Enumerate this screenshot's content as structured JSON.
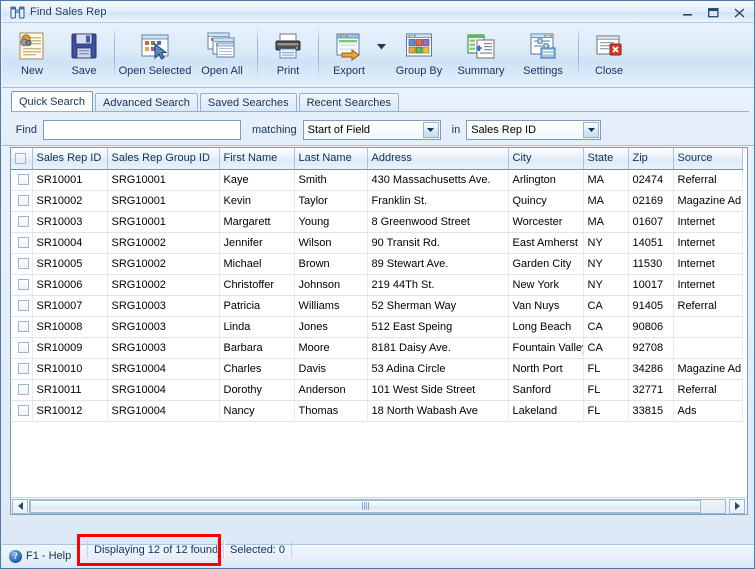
{
  "window": {
    "title": "Find Sales Rep",
    "icon": "binoculars-icon",
    "minimize_label": "Minimize",
    "maximize_label": "Maximize",
    "close_label": "Close"
  },
  "toolbar": {
    "buttons": [
      {
        "label": "New",
        "icon": "new-record-icon"
      },
      {
        "label": "Save",
        "icon": "floppy-disk-icon"
      },
      {
        "label": "Open Selected",
        "icon": "open-selected-icon"
      },
      {
        "label": "Open All",
        "icon": "open-all-icon"
      },
      {
        "label": "Print",
        "icon": "printer-icon"
      },
      {
        "label": "Export",
        "icon": "export-icon"
      },
      {
        "label": "Group By",
        "icon": "group-by-icon"
      },
      {
        "label": "Summary",
        "icon": "summary-icon"
      },
      {
        "label": "Settings",
        "icon": "settings-icon"
      },
      {
        "label": "Close",
        "icon": "close-window-icon"
      }
    ]
  },
  "search": {
    "tabs": [
      {
        "label": "Quick Search",
        "active": true
      },
      {
        "label": "Advanced Search",
        "active": false
      },
      {
        "label": "Saved Searches",
        "active": false
      },
      {
        "label": "Recent Searches",
        "active": false
      }
    ],
    "find_label": "Find",
    "find_value": "",
    "find_placeholder": "",
    "matching_label": "matching",
    "matching_value": "Start of Field",
    "in_label": "in",
    "in_value": "Sales Rep ID"
  },
  "grid": {
    "columns": [
      "Sales Rep ID",
      "Sales Rep Group ID",
      "First Name",
      "Last Name",
      "Address",
      "City",
      "State",
      "Zip",
      "Source"
    ],
    "rows": [
      [
        "SR10001",
        "SRG10001",
        "Kaye",
        "Smith",
        "430 Massachusetts Ave.",
        "Arlington",
        "MA",
        "02474",
        "Referral"
      ],
      [
        "SR10002",
        "SRG10001",
        "Kevin",
        "Taylor",
        "Franklin St.",
        "Quincy",
        "MA",
        "02169",
        "Magazine Ad"
      ],
      [
        "SR10003",
        "SRG10001",
        "Margarett",
        "Young",
        "8 Greenwood Street",
        "Worcester",
        "MA",
        "01607",
        "Internet"
      ],
      [
        "SR10004",
        "SRG10002",
        "Jennifer",
        "Wilson",
        "90 Transit Rd.",
        "East Amherst",
        "NY",
        "14051",
        "Internet"
      ],
      [
        "SR10005",
        "SRG10002",
        "Michael",
        "Brown",
        "89 Stewart Ave.",
        "Garden City",
        "NY",
        "11530",
        "Internet"
      ],
      [
        "SR10006",
        "SRG10002",
        "Christoffer",
        "Johnson",
        "219 44Th St.",
        "New York",
        "NY",
        "10017",
        "Internet"
      ],
      [
        "SR10007",
        "SRG10003",
        "Patricia",
        "Williams",
        "52 Sherman Way",
        "Van Nuys",
        "CA",
        "91405",
        "Referral"
      ],
      [
        "SR10008",
        "SRG10003",
        "Linda",
        "Jones",
        "512 East Speing",
        "Long Beach",
        "CA",
        "90806",
        ""
      ],
      [
        "SR10009",
        "SRG10003",
        "Barbara",
        "Moore",
        "8181 Daisy Ave.",
        "Fountain Valley",
        "CA",
        "92708",
        ""
      ],
      [
        "SR10010",
        "SRG10004",
        "Charles",
        "Davis",
        "53 Adina Circle",
        "North Port",
        "FL",
        "34286",
        "Magazine Ad"
      ],
      [
        "SR10011",
        "SRG10004",
        "Dorothy",
        "Anderson",
        "101 West Side Street",
        "Sanford",
        "FL",
        "32771",
        "Referral"
      ],
      [
        "SR10012",
        "SRG10004",
        "Nancy",
        "Thomas",
        "18 North Wabash Ave",
        "Lakeland",
        "FL",
        "33815",
        "Ads"
      ]
    ]
  },
  "statusbar": {
    "help_label": "F1 - Help",
    "displaying_label": "Displaying 12 of 12 found",
    "selected_label": "Selected: 0"
  },
  "annotation": {
    "color": "#ff0000",
    "target": "Displaying 12 of 12 found"
  }
}
